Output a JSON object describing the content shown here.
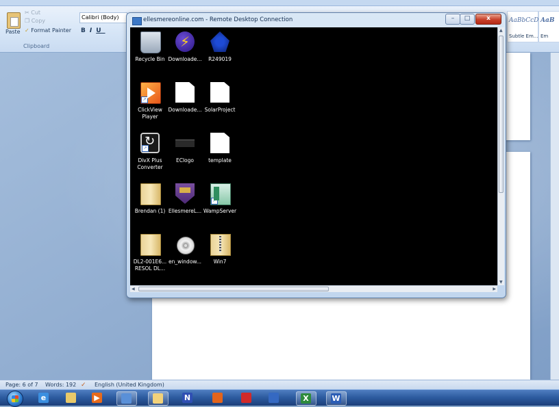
{
  "ribbon": {
    "clipboard": {
      "paste_label": "Paste",
      "cut_label": "Cut",
      "copy_label": "Copy",
      "format_painter_label": "Format Painter",
      "group_label": "Clipboard"
    },
    "font": {
      "font_name": "Calibri (Body)",
      "bold": "B",
      "italic": "I",
      "underline": "U"
    },
    "styles": [
      {
        "sample": "AaBbCcDc",
        "name": "Subtle Em..."
      },
      {
        "sample": "AaB",
        "name": "Em"
      }
    ]
  },
  "rdp_window": {
    "title": "ellesmereonline.com - Remote Desktop Connection",
    "minimize": "–",
    "maximize": "□",
    "close": "x",
    "desktop_icons": [
      {
        "label": "Recycle Bin",
        "icon": "recycle-bin-icon",
        "shortcut": false
      },
      {
        "label": "Downloade...",
        "icon": "lightning-app-icon",
        "shortcut": false
      },
      {
        "label": "R249019",
        "icon": "r249019-app-icon",
        "shortcut": false
      },
      {
        "label": "ClickView Player",
        "icon": "clickview-player-icon",
        "shortcut": true
      },
      {
        "label": "Downloade...",
        "icon": "document-icon",
        "shortcut": false
      },
      {
        "label": "SolarProject",
        "icon": "document-icon",
        "shortcut": false
      },
      {
        "label": "DivX Plus Converter",
        "icon": "divx-converter-icon",
        "shortcut": true
      },
      {
        "label": "EClogo",
        "icon": "image-file-icon",
        "shortcut": false
      },
      {
        "label": "template",
        "icon": "document-icon",
        "shortcut": false
      },
      {
        "label": "Brendan (1)",
        "icon": "folder-icon",
        "shortcut": false
      },
      {
        "label": "EllesmereL...",
        "icon": "shield-logo-icon",
        "shortcut": false
      },
      {
        "label": "WampServer",
        "icon": "wampserver-icon",
        "shortcut": true
      },
      {
        "label": "DL2-001E6... RESOL DL...",
        "icon": "folder-icon",
        "shortcut": false
      },
      {
        "label": "en_window...",
        "icon": "disc-image-icon",
        "shortcut": false
      },
      {
        "label": "Win7",
        "icon": "zip-folder-icon",
        "shortcut": false
      }
    ]
  },
  "statusbar": {
    "page": "Page: 6 of 7",
    "words": "Words: 192",
    "language": "English (United Kingdom)"
  },
  "taskbar": {
    "items": [
      {
        "name": "ie-taskbar-icon",
        "glyph": "e",
        "color": "#3b8fe0"
      },
      {
        "name": "explorer-taskbar-icon",
        "glyph": "",
        "color": "#e8c96a"
      },
      {
        "name": "media-player-taskbar-icon",
        "glyph": "▶",
        "color": "#e76a1b"
      },
      {
        "name": "remote-desktop-taskbar-icon",
        "glyph": "",
        "color": "#5a90d8"
      },
      {
        "name": "paint-taskbar-icon",
        "glyph": "",
        "color": "#f2d27a"
      },
      {
        "name": "onenote-taskbar-icon",
        "glyph": "N",
        "color": "#2f4fb3"
      },
      {
        "name": "firefox-taskbar-icon",
        "glyph": "",
        "color": "#e2641c"
      },
      {
        "name": "acrobat-taskbar-icon",
        "glyph": "",
        "color": "#d12a2a"
      },
      {
        "name": "network-taskbar-icon",
        "glyph": "",
        "color": "#3569c2"
      },
      {
        "name": "excel-taskbar-icon",
        "glyph": "X",
        "color": "#2e8b3d"
      },
      {
        "name": "word-taskbar-icon",
        "glyph": "W",
        "color": "#2b5db5"
      }
    ]
  }
}
